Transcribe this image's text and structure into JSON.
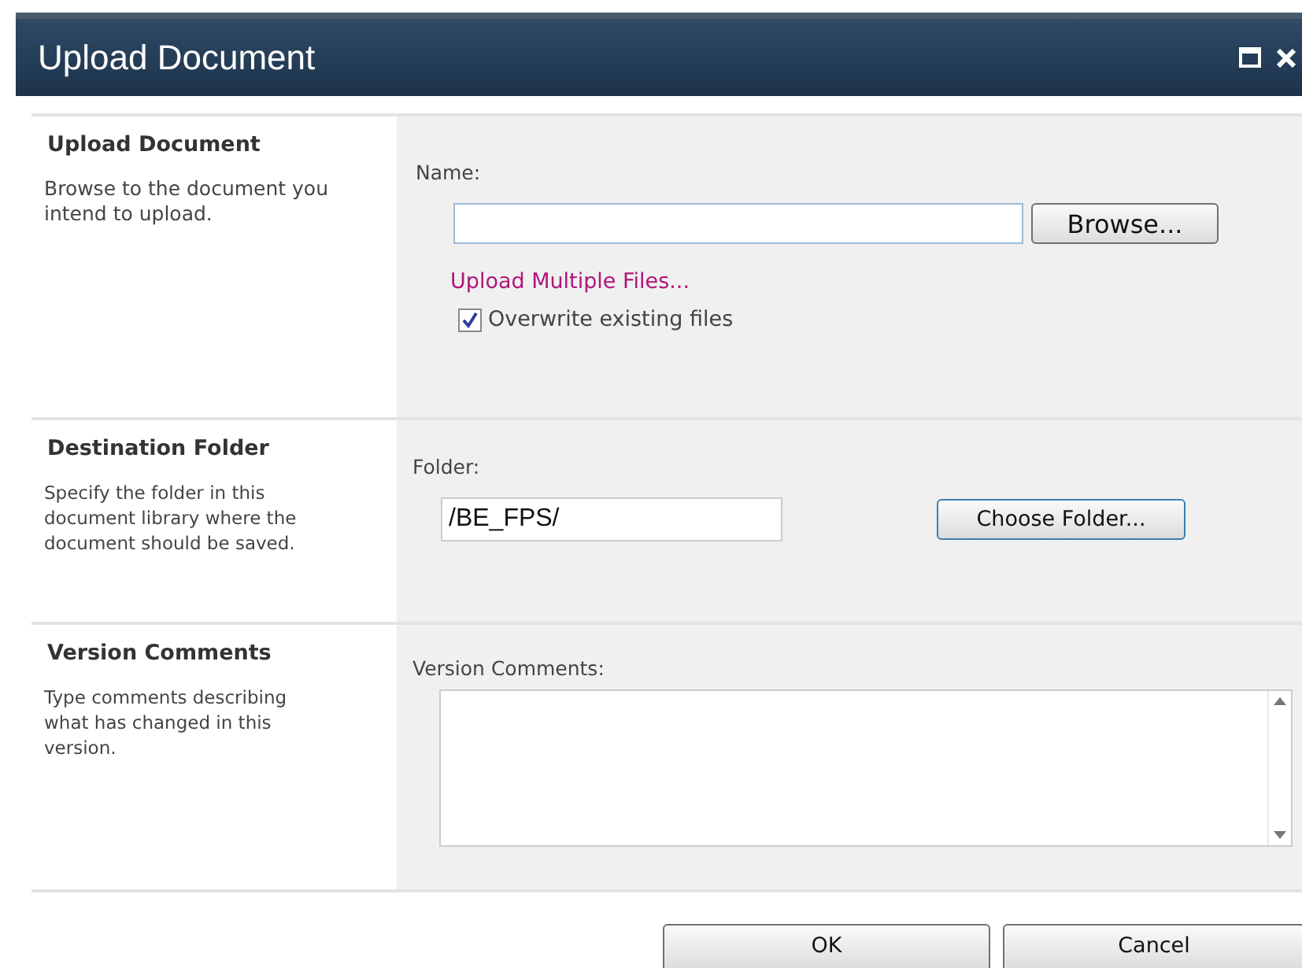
{
  "window": {
    "title": "Upload Document"
  },
  "sections": [
    {
      "kind": "file",
      "heading": "Upload Document",
      "description": "Browse to the document you intend to upload.",
      "label": "Name:",
      "button": "Browse...",
      "link": "Upload Multiple Files...",
      "checkbox": {
        "label": "Overwrite existing files",
        "checked": true
      }
    },
    {
      "kind": "folder",
      "heading": "Destination Folder",
      "description": "Specify the folder in this document library where the document should be saved.",
      "label": "Folder:",
      "value": "/BE_FPS/",
      "button": "Choose Folder..."
    },
    {
      "kind": "comments",
      "heading": "Version Comments",
      "description": "Type comments describing what has changed in this version.",
      "label": "Version Comments:"
    }
  ],
  "buttons": [
    "OK",
    "Cancel"
  ]
}
